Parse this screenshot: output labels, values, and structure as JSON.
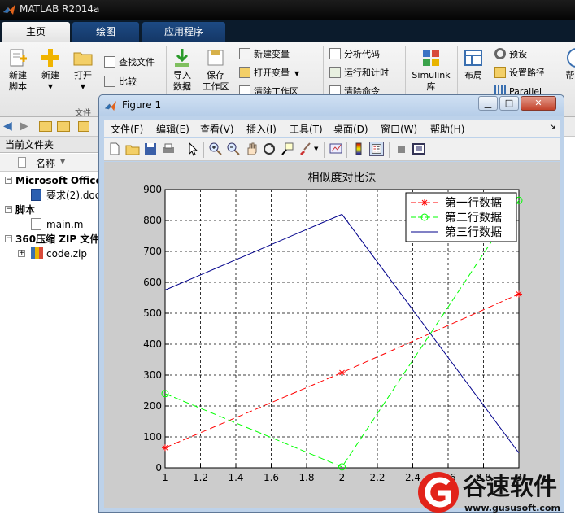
{
  "app": {
    "title": "MATLAB R2014a"
  },
  "tabs": [
    {
      "label": "主页",
      "active": true
    },
    {
      "label": "绘图",
      "active": false
    },
    {
      "label": "应用程序",
      "active": false
    }
  ],
  "ribbon": {
    "new_script": "新建\n脚本",
    "new": "新建",
    "open": "打开",
    "find_files": "查找文件",
    "compare": "比较",
    "import_data": "导入\n数据",
    "save_workspace": "保存\n工作区",
    "new_variable": "新建变量",
    "open_variable": "打开变量",
    "clear_workspace": "清除工作区",
    "analyze_code": "分析代码",
    "run_and_time": "运行和计时",
    "clear_commands": "清除命令",
    "simulink": "Simulink\n库",
    "layout": "布局",
    "preferences": "预设",
    "set_path": "设置路径",
    "parallel": "Parallel",
    "help": "帮",
    "file_group": "文件"
  },
  "current_folder": {
    "header": "当前文件夹",
    "column_name": "名称",
    "groups": [
      {
        "label": "Microsoft Office",
        "items": [
          "要求(2).doc"
        ]
      },
      {
        "label": "脚本",
        "items": [
          "main.m"
        ]
      },
      {
        "label": "360压缩 ZIP 文件",
        "items": [
          "code.zip"
        ]
      }
    ]
  },
  "figure": {
    "title": "Figure 1",
    "menu": [
      "文件(F)",
      "编辑(E)",
      "查看(V)",
      "插入(I)",
      "工具(T)",
      "桌面(D)",
      "窗口(W)",
      "帮助(H)"
    ]
  },
  "chart_data": {
    "type": "line",
    "title": "相似度对比法",
    "x": [
      1,
      2,
      3
    ],
    "xlim": [
      1,
      3
    ],
    "ylim": [
      0,
      900
    ],
    "xticks": [
      "1",
      "1.2",
      "1.4",
      "1.6",
      "1.8",
      "2",
      "2.2",
      "2.4",
      "2.6",
      "2.8",
      "3"
    ],
    "yticks": [
      "0",
      "100",
      "200",
      "300",
      "400",
      "500",
      "600",
      "700",
      "800",
      "900"
    ],
    "grid": true,
    "grid_style": "dashed",
    "legend_position": "top-right",
    "series": [
      {
        "name": "第一行数据",
        "values": [
          65,
          308,
          562
        ],
        "color": "#ff0000",
        "line": "dashed",
        "marker": "star"
      },
      {
        "name": "第二行数据",
        "values": [
          240,
          3,
          865
        ],
        "color": "#00ff00",
        "line": "dashed",
        "marker": "circle"
      },
      {
        "name": "第三行数据",
        "values": [
          575,
          820,
          48
        ],
        "color": "#00008b",
        "line": "solid",
        "marker": "none"
      }
    ]
  },
  "watermark": {
    "brand": "谷速软件",
    "url": "www.gususoft.com"
  }
}
